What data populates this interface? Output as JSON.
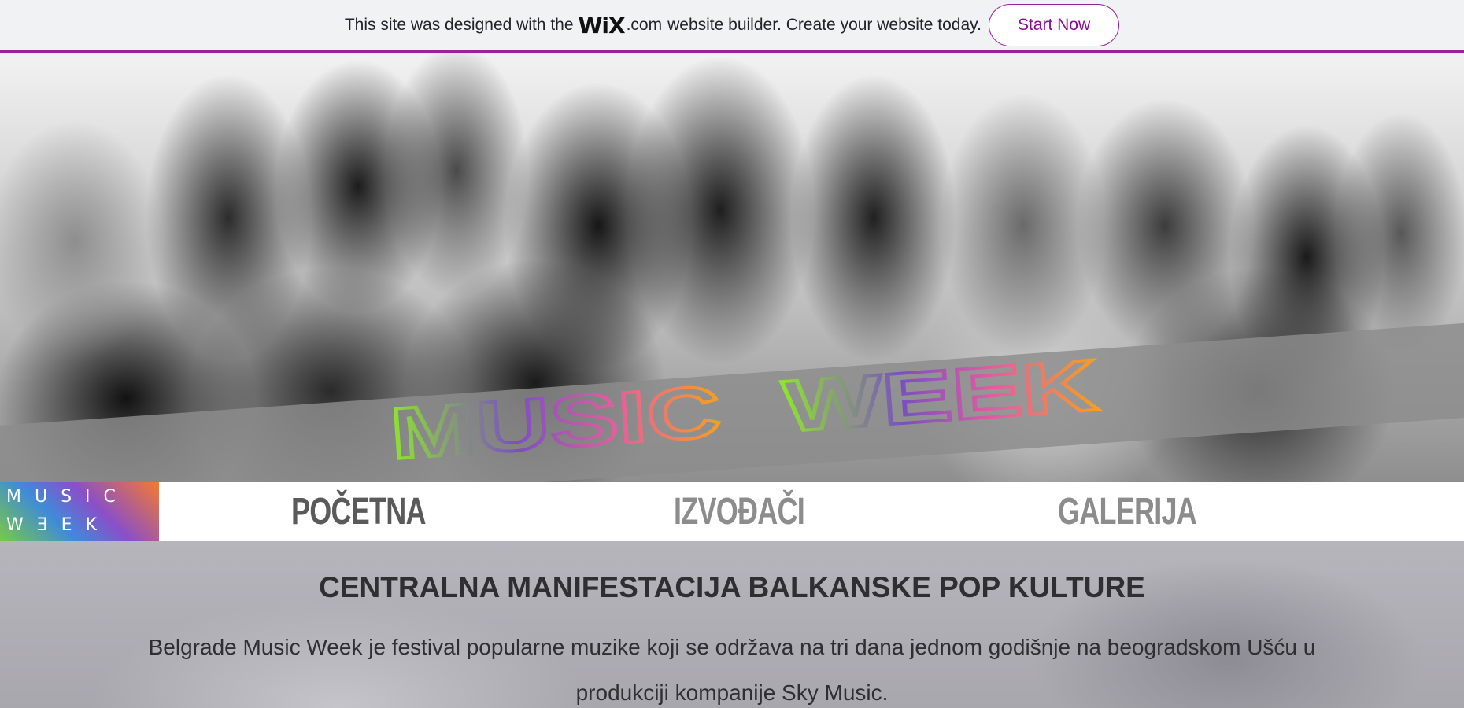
{
  "wix_banner": {
    "text_before": "This site was designed with the",
    "logo": "WiX",
    "logo_suffix": ".com",
    "text_after": "website builder. Create your website today.",
    "button_label": "Start Now"
  },
  "hero": {
    "title_word_1": "MUSIC",
    "title_word_2": "WEEK",
    "title_gradient": [
      "#8ee62c",
      "#7a4fc2",
      "#e55da0",
      "#f5a01f"
    ]
  },
  "nav": {
    "logo_line_1": "MUSIC",
    "logo_line_2": "WƎEK",
    "items": [
      {
        "label": "POČETNA",
        "active": true
      },
      {
        "label": "IZVOĐAČI",
        "active": false
      },
      {
        "label": "GALERIJA",
        "active": false
      }
    ]
  },
  "content": {
    "heading": "CENTRALNA MANIFESTACIJA BALKANSKE POP KULTURE",
    "paragraph": "Belgrade Music Week je festival popularne muzike koji se održava na tri dana jednom godišnje na beogradskom Ušću u produkciji kompanije Sky Music."
  },
  "colors": {
    "banner_bg": "#f1f2f4",
    "banner_accent": "#9b1fa3",
    "nav_active": "#5a5a5a",
    "nav_inactive": "#8c8c8c"
  }
}
